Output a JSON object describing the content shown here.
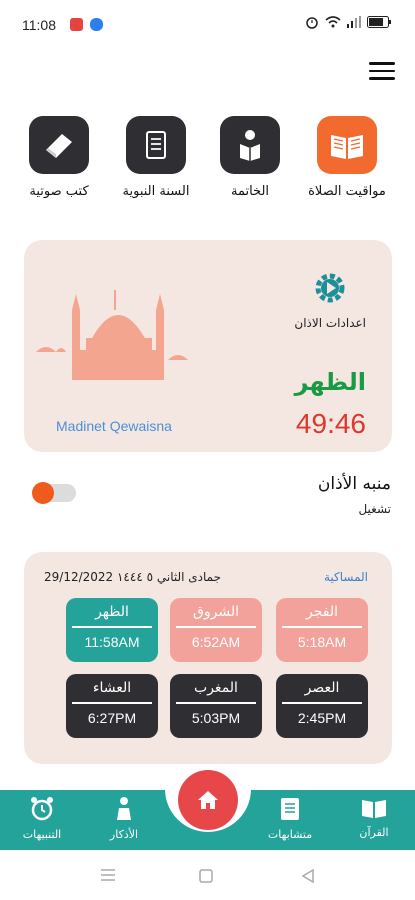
{
  "status_bar": {
    "time": "11:08",
    "right_icons": [
      "alarm-icon",
      "wifi-icon",
      "signal-icon",
      "battery-icon"
    ]
  },
  "colors": {
    "accent_orange": "#f26a2e",
    "dark_tile": "#2f2f33",
    "teal": "#23a39a",
    "salmon": "#f2a29a",
    "red": "#e8474a",
    "green": "#1a9a45"
  },
  "quick_tiles": [
    {
      "label": "مواقيت الصلاة",
      "icon": "book-icon"
    },
    {
      "label": "الخاتمة",
      "icon": "reader-icon"
    },
    {
      "label": "السنة النبوية",
      "icon": "scroll-icon"
    },
    {
      "label": "كتب صوتية",
      "icon": "audio-book-icon"
    }
  ],
  "adhan_card": {
    "settings_label": "اعدادات الاذان",
    "current_prayer": "الظهر",
    "countdown": "49:46",
    "location": "Madinet Qewaisna"
  },
  "alarm": {
    "title": "منبه الأذان",
    "subtitle": "تشغيل",
    "enabled": true
  },
  "times": {
    "city": "المساكية",
    "date": "29/12/2022 جمادى الثاني ٥ ١٤٤٤",
    "prayers": [
      {
        "name": "الفجر",
        "time": "5:18AM"
      },
      {
        "name": "الشروق",
        "time": "6:52AM"
      },
      {
        "name": "الظهر",
        "time": "11:58AM"
      },
      {
        "name": "العصر",
        "time": "2:45PM"
      },
      {
        "name": "المغرب",
        "time": "5:03PM"
      },
      {
        "name": "العشاء",
        "time": "6:27PM"
      }
    ]
  },
  "bottom_nav": [
    {
      "label": "القرآن",
      "icon": "quran-icon"
    },
    {
      "label": "متشابهات",
      "icon": "document-icon"
    },
    {
      "label": "الأذكار",
      "icon": "prayer-person-icon"
    },
    {
      "label": "التنبيهات",
      "icon": "alarm-clock-icon"
    }
  ]
}
